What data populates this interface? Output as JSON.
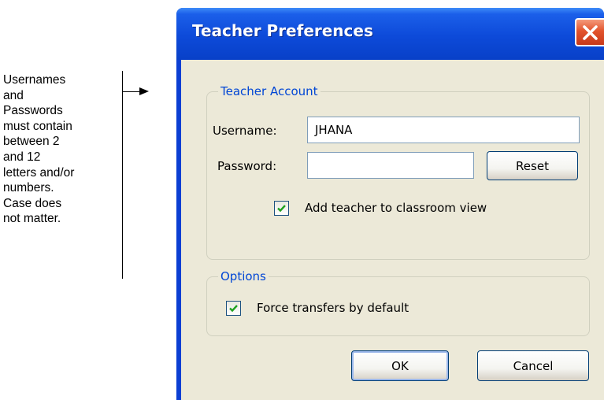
{
  "annotation": {
    "lines": [
      "Usernames",
      "and",
      "Passwords",
      "must contain",
      "between 2",
      "and 12",
      "letters and/or",
      "numbers.",
      "Case does",
      "not matter."
    ]
  },
  "dialog": {
    "title": "Teacher Preferences",
    "teacher_account": {
      "group_title": "Teacher Account",
      "username_label": "Username:",
      "username_value": "JHANA",
      "password_label": "Password:",
      "password_value": "",
      "reset_label": "Reset",
      "add_teacher_label": "Add teacher to classroom view",
      "add_teacher_checked": true
    },
    "options": {
      "group_title": "Options",
      "force_transfers_label": "Force transfers by default",
      "force_transfers_checked": true
    },
    "ok_label": "OK",
    "cancel_label": "Cancel"
  },
  "colors": {
    "title_bar": "#0d4ad9",
    "dialog_face": "#ece9d8",
    "group_title_text": "#0046d5",
    "close_button": "#e2532c",
    "checkmark": "#21a121"
  },
  "icons": [
    "close-icon",
    "checkmark-icon",
    "arrow-right-icon"
  ]
}
